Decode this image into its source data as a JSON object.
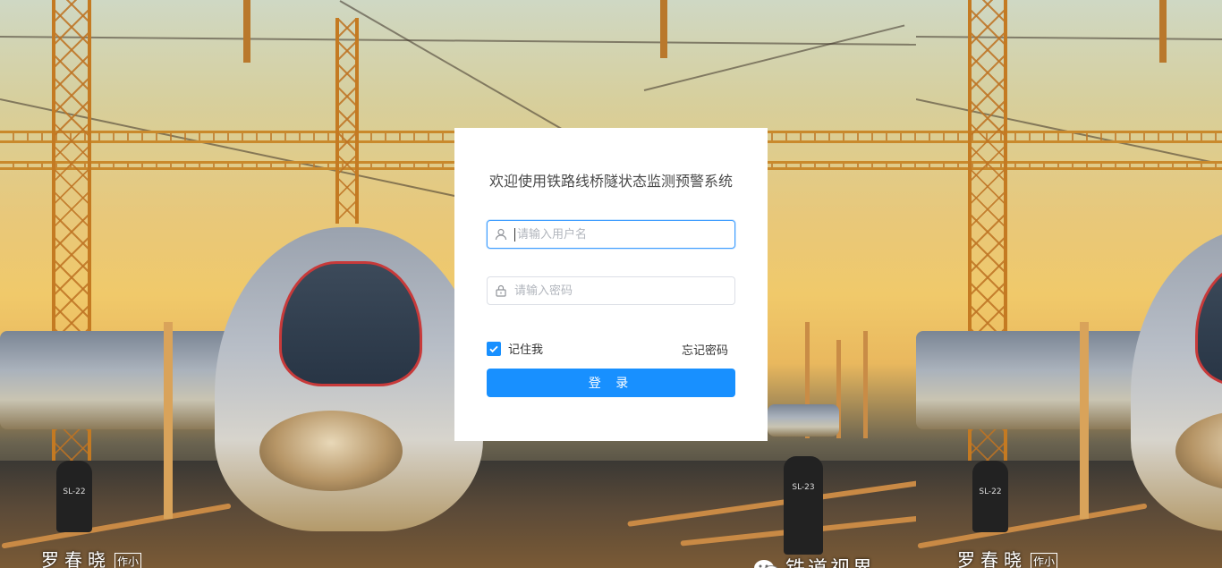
{
  "login": {
    "title": "欢迎使用铁路线桥隧状态监测预警系统",
    "username": {
      "placeholder": "请输入用户名",
      "value": ""
    },
    "password": {
      "placeholder": "请输入密码",
      "value": ""
    },
    "remember_label": "记住我",
    "remember_checked": true,
    "forgot_label": "忘记密码",
    "submit_label": "登 录"
  },
  "background": {
    "watermark_author": "罗春晓",
    "watermark_tag": "作小",
    "watermark_source": "铁道视界"
  },
  "colors": {
    "accent": "#1890ff",
    "input_focus": "#409eff",
    "card_bg": "#ffffff"
  },
  "icons": {
    "username": "user-icon",
    "password": "lock-icon",
    "checkbox": "check-icon",
    "wechat": "wechat-icon"
  }
}
